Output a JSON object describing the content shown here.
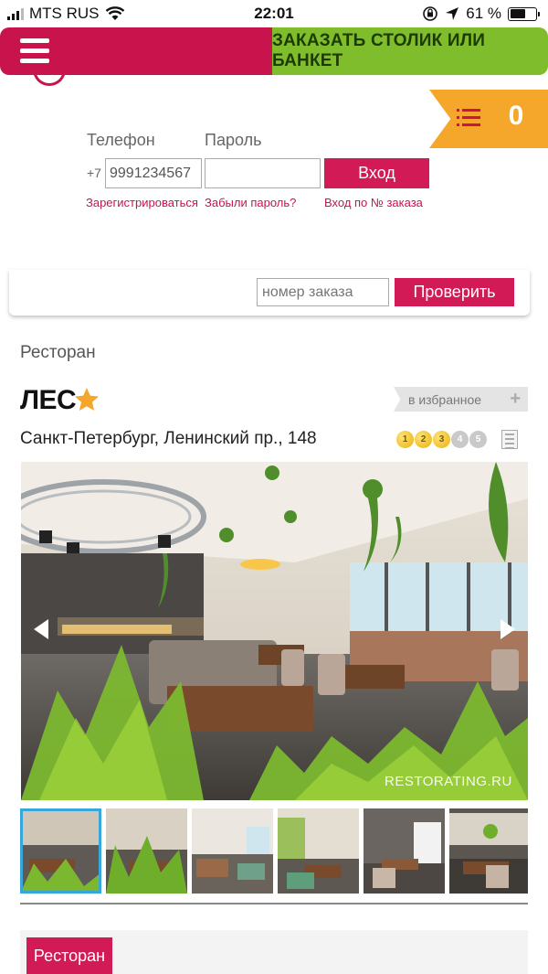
{
  "status_bar": {
    "carrier": "MTS RUS",
    "time": "22:01",
    "battery_percent": "61 %",
    "battery_level": 0.61
  },
  "header": {
    "menu_icon": "hamburger-icon",
    "order_button_label": "ЗАКАЗАТЬ СТОЛИК ИЛИ БАНКЕТ",
    "cart_count": "0",
    "colors": {
      "brand": "#c8134c",
      "order": "#7fbd2c",
      "cart": "#f4a72a"
    }
  },
  "login": {
    "phone_label": "Телефон",
    "password_label": "Пароль",
    "phone_prefix": "+7",
    "phone_value": "9991234567",
    "password_value": "",
    "login_button": "Вход",
    "register_link": "Зарегистрироваться",
    "forgot_link": "Забыли пароль?",
    "order_login_link": "Вход по № заказа"
  },
  "order_check": {
    "placeholder": "номер заказа",
    "button": "Проверить"
  },
  "restaurant": {
    "category": "Ресторан",
    "name": "ЛЕС",
    "favorite_label": "в избранное",
    "favorite_plus": "+",
    "address": "Санкт-Петербург, Ленинский пр., 148",
    "price_level": 3,
    "price_scale": [
      "1",
      "2",
      "3",
      "4",
      "5"
    ]
  },
  "gallery": {
    "watermark": "RESTORATING.RU",
    "thumbnail_count": 6,
    "active_index": 0
  },
  "bottom": {
    "tab_label": "Ресторан"
  }
}
